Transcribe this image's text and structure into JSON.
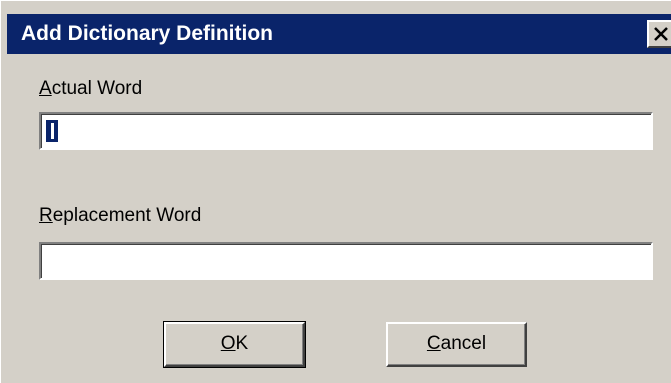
{
  "window": {
    "title": "Add Dictionary Definition",
    "close_icon": "close-icon"
  },
  "form": {
    "actual_word": {
      "label_accel": "A",
      "label_rest": "ctual Word",
      "value": ""
    },
    "replacement_word": {
      "label_accel": "R",
      "label_rest": "eplacement Word",
      "value": ""
    }
  },
  "buttons": {
    "ok": {
      "accel": "O",
      "rest": "K"
    },
    "cancel": {
      "accel": "C",
      "rest": "ancel"
    }
  },
  "colors": {
    "titlebar": "#0a246a",
    "dialog_face": "#d4d0c8"
  }
}
